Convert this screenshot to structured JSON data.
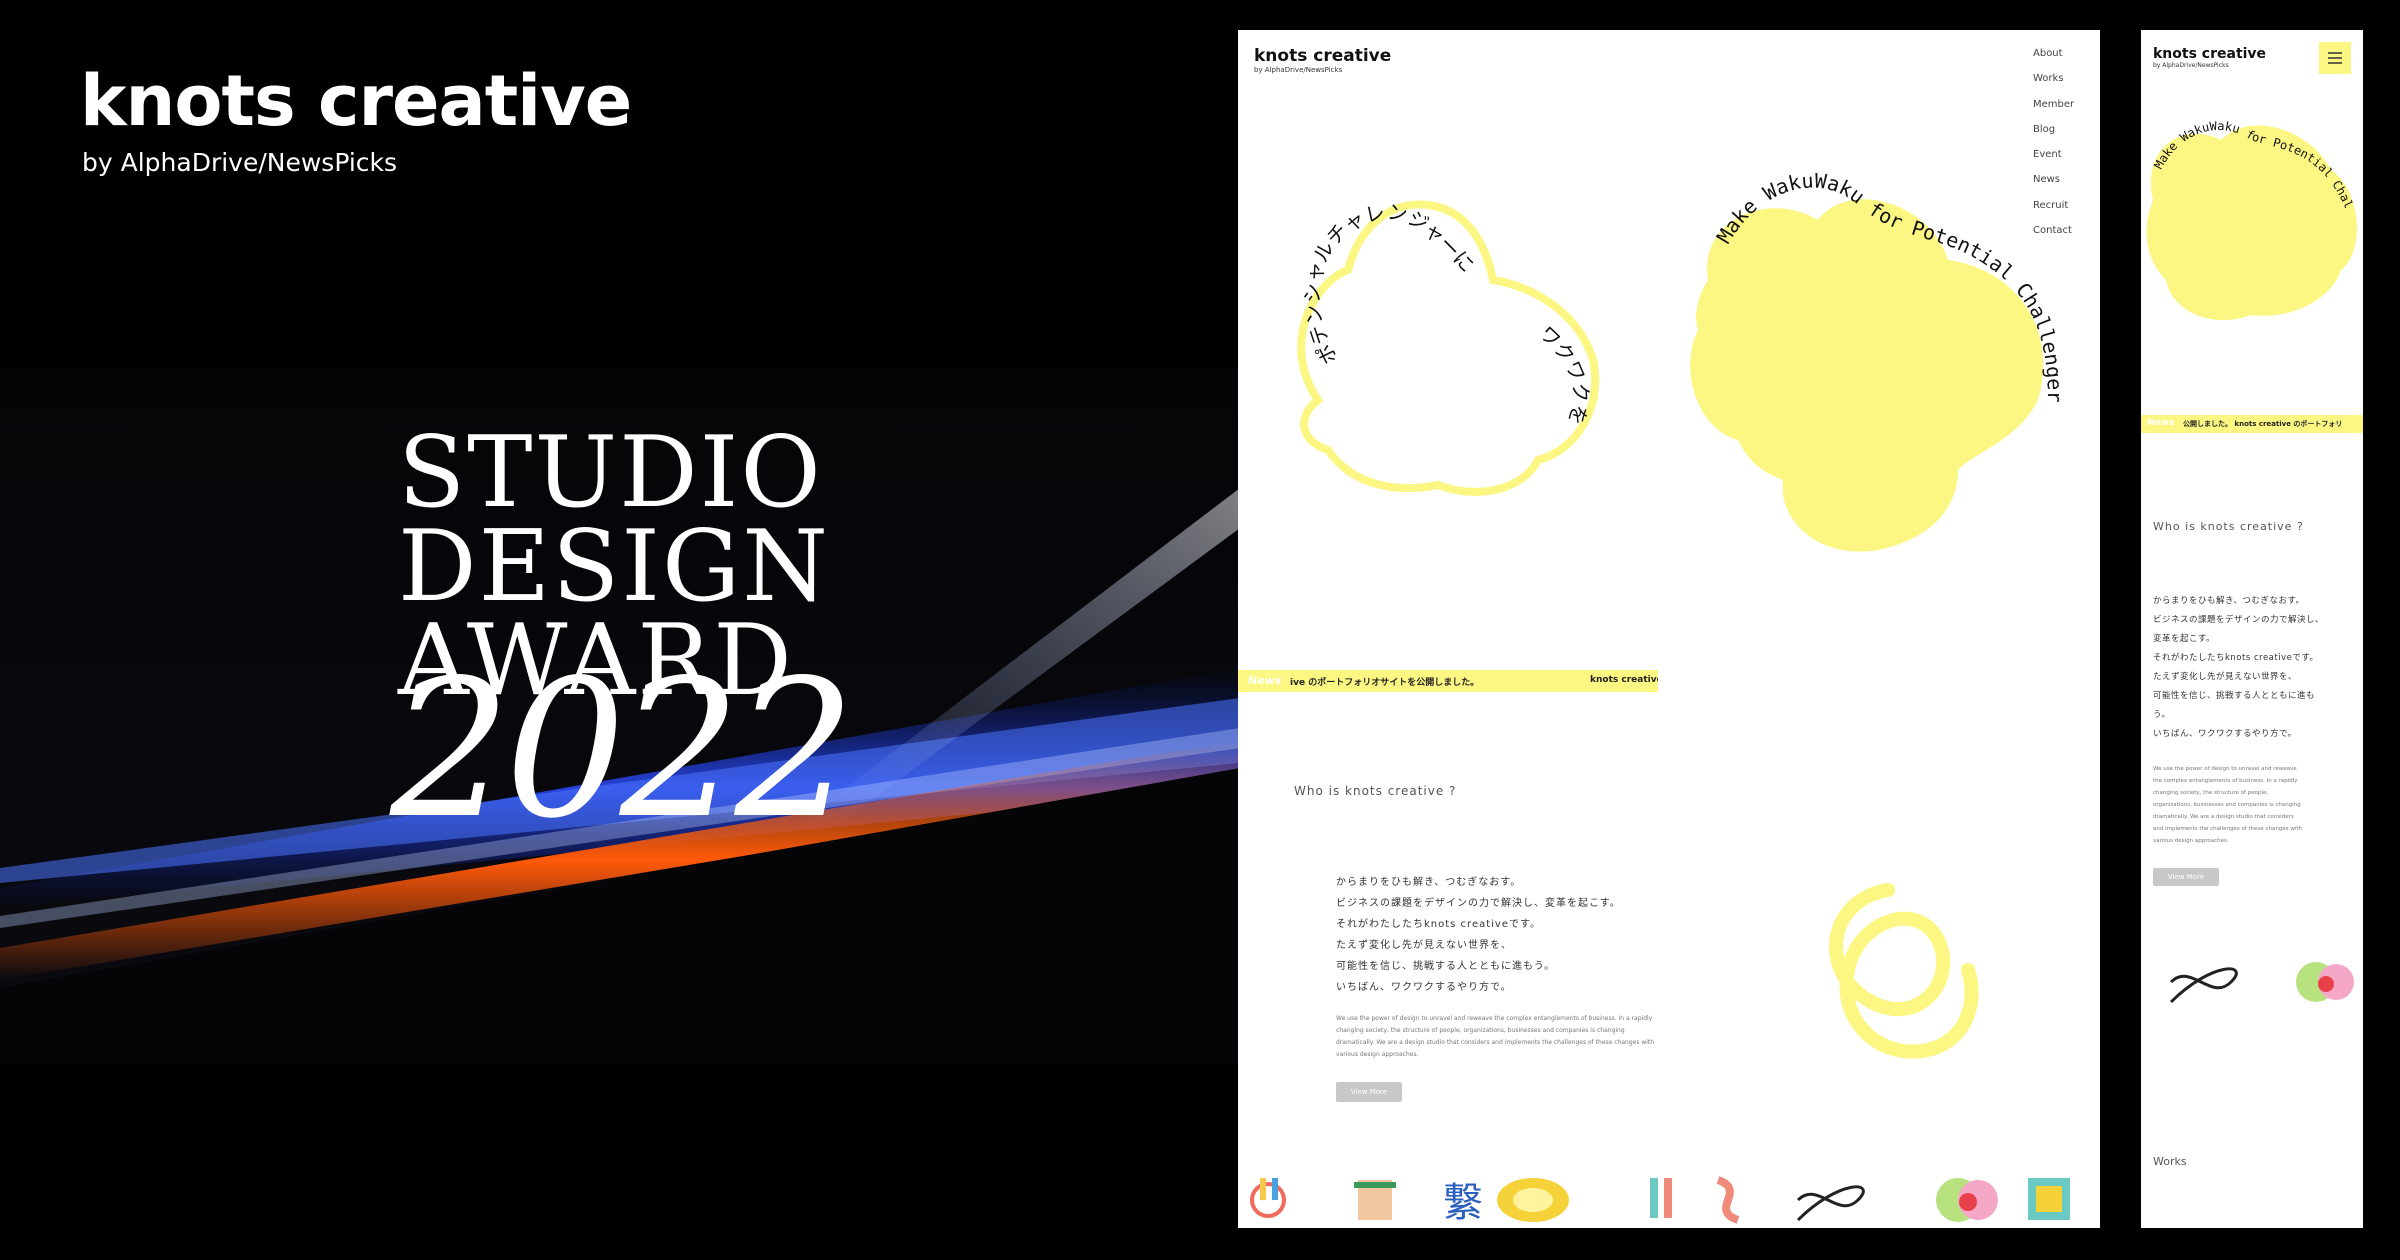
{
  "brand": {
    "title": "knots creative",
    "subtitle": "by AlphaDrive/NewsPicks"
  },
  "award": {
    "line1": "STUDIO",
    "line2": "DESIGN",
    "line3": "AWARD",
    "year": "2022"
  },
  "desktop": {
    "logo": "knots creative",
    "sublogo": "by AlphaDrive/NewsPicks",
    "nav": [
      "About",
      "Works",
      "Member",
      "Blog",
      "Event",
      "News",
      "Recruit",
      "Contact"
    ],
    "arc_jp": "ポテンシャルチャレンジャーに",
    "arc_jp2": "ワクワクを",
    "arc_en": "Make WakuWaku for Potential Challenger",
    "news_label": "News",
    "news_text": "ive のポートフォリオサイトを公開しました。",
    "news_brand": "knots creative",
    "who_heading": "Who is knots creative ?",
    "intro_lines": [
      "からまりをひも解き、つむぎなおす。",
      "ビジネスの課題をデザインの力で解決し、変革を起こす。",
      "それがわたしたちknots creativeです。",
      "たえず変化し先が見えない世界を、",
      "可能性を信じ、挑戦する人とともに進もう。",
      "いちばん、ワクワクするやり方で。"
    ],
    "en_lines": [
      "We use the power of design to unravel and reweave the complex entanglements of business. In a rapidly",
      "changing society, the structure of people, organizations, businesses and companies is changing",
      "dramatically. We are a design studio that considers and implements the challenges of these changes with",
      "various design approaches."
    ],
    "view_more": "View More"
  },
  "mobile": {
    "logo": "knots creative",
    "sublogo": "by AlphaDrive/NewsPicks",
    "arc_en": "Make WakuWaku for Potential Challenger",
    "news_label": "News",
    "news_text": "公開しました。 knots creative のポートフォリ",
    "who_heading": "Who is knots creative ?",
    "intro_lines": [
      "からまりをひも解き、つむぎなおす。",
      "ビジネスの課題をデザインの力で解決し、",
      "変革を起こす。",
      "それがわたしたちknots creativeです。",
      "たえず変化し先が見えない世界を、",
      "可能性を信じ、挑戦する人とともに進も",
      "う。",
      "いちばん、ワクワクするやり方で。"
    ],
    "en_lines": [
      "We use the power of design to unravel and reweave",
      "the complex entanglements of business. In a rapidly",
      "changing society, the structure of people,",
      "organizations, businesses and companies is changing",
      "dramatically. We are a design studio that considers",
      "and implements the challenges of these changes with",
      "various design approaches."
    ],
    "view_more": "View More",
    "works": "Works"
  },
  "colors": {
    "accent": "#fcf783",
    "background": "#000000"
  }
}
